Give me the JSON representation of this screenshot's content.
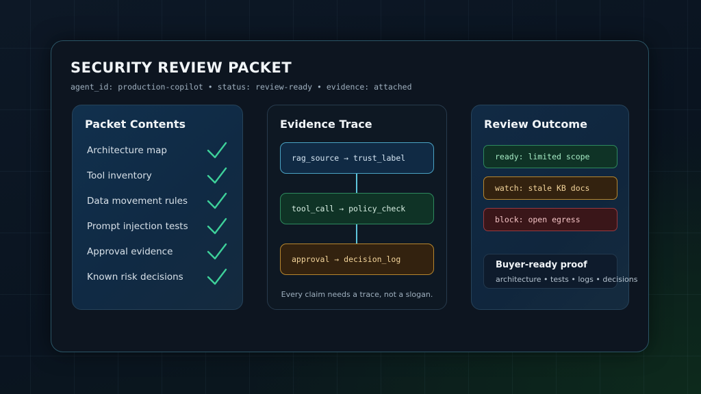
{
  "header": {
    "title": "SECURITY REVIEW PACKET",
    "meta": "agent_id: production-copilot • status: review-ready • evidence: attached"
  },
  "packet_contents": {
    "title": "Packet Contents",
    "items": [
      {
        "label": "Architecture map",
        "icon": "check-icon"
      },
      {
        "label": "Tool inventory",
        "icon": "check-icon"
      },
      {
        "label": "Data movement rules",
        "icon": "check-icon"
      },
      {
        "label": "Prompt injection tests",
        "icon": "check-icon"
      },
      {
        "label": "Approval evidence",
        "icon": "check-icon"
      },
      {
        "label": "Known risk decisions",
        "icon": "check-icon"
      }
    ]
  },
  "evidence_trace": {
    "title": "Evidence Trace",
    "steps": [
      {
        "label": "rag_source → trust_label",
        "color": "#4aa3c4"
      },
      {
        "label": "tool_call → policy_check",
        "color": "#2e8a5e"
      },
      {
        "label": "approval → decision_log",
        "color": "#b8872e"
      }
    ],
    "caption": "Every claim needs a trace, not a slogan."
  },
  "review_outcome": {
    "title": "Review Outcome",
    "statuses": [
      {
        "label": "ready: limited scope",
        "color": "#2e8a5e"
      },
      {
        "label": "watch: stale KB docs",
        "color": "#b8872e"
      },
      {
        "label": "block: open egress",
        "color": "#9b3a40"
      }
    ],
    "proof": {
      "title": "Buyer-ready proof",
      "subtitle": "architecture • tests • logs • decisions"
    }
  },
  "colors": {
    "accent_check": "#3ed19a",
    "connector": "#5fc6dc"
  }
}
